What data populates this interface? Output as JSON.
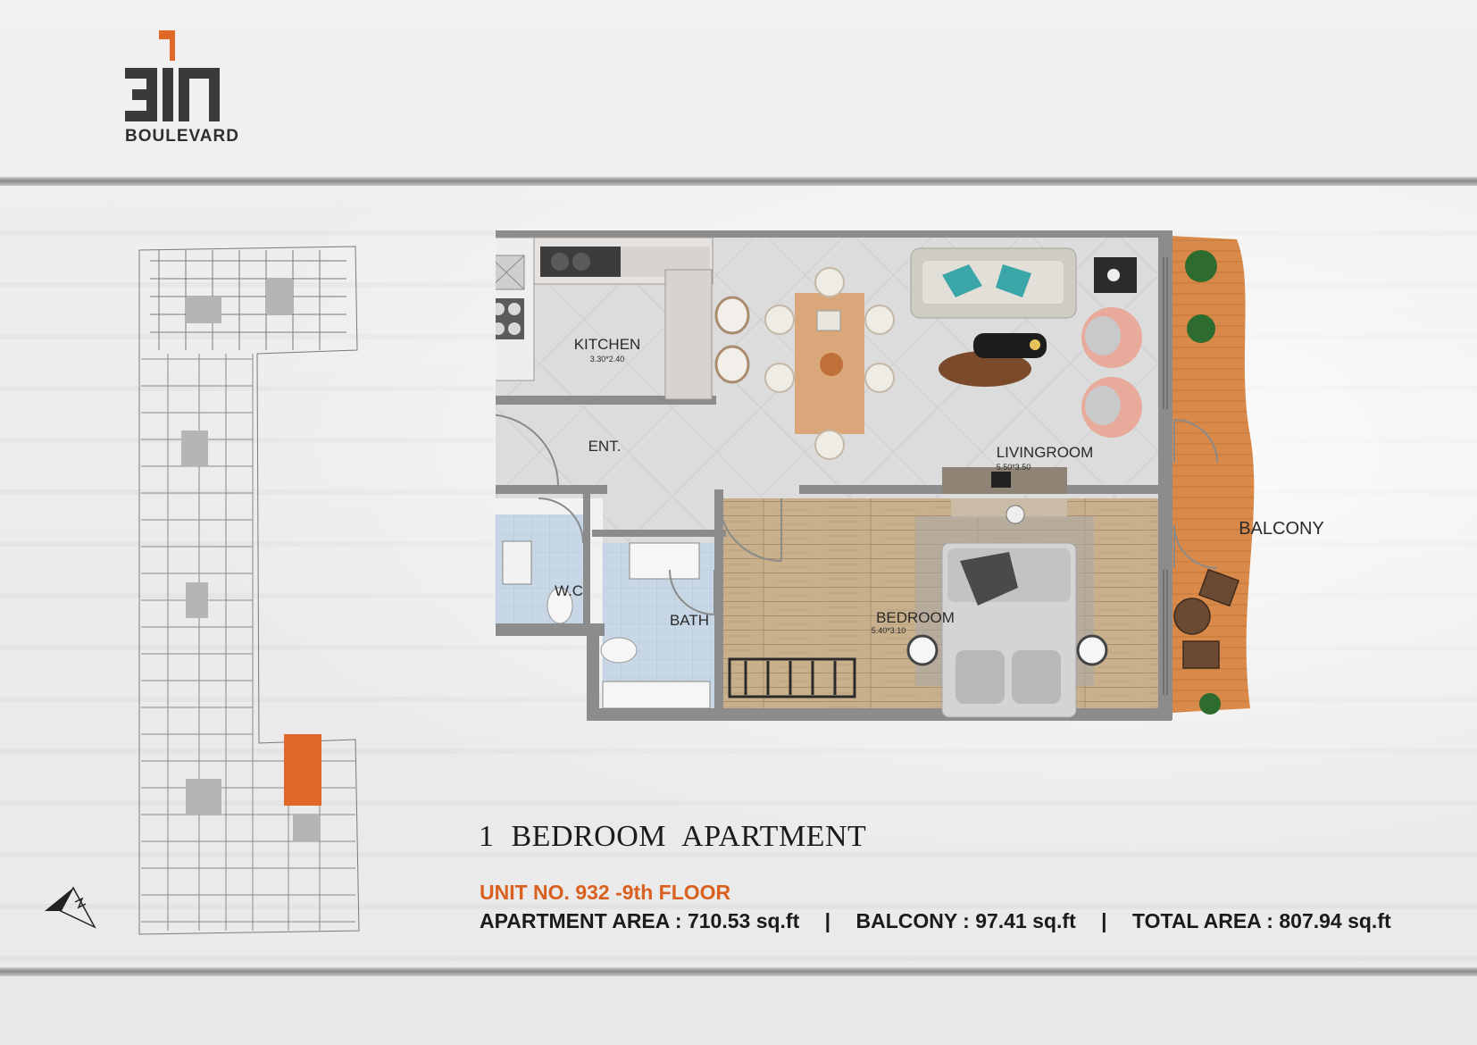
{
  "brand": {
    "logo_number": "311",
    "logo_word": "BOULEVARD",
    "accent": "#e0692a"
  },
  "plan_labels": {
    "kitchen": "KITCHEN",
    "kitchen_dims": "3.30*2.40",
    "entrance": "ENT.",
    "livingroom": "LIVINGROOM",
    "livingroom_dims": "5.50*3.50",
    "wc": "W.C",
    "bath": "BATH",
    "bedroom": "BEDROOM",
    "bedroom_dims": "5.40*3.10",
    "balcony": "BALCONY"
  },
  "title": "1 BEDROOM APARTMENT",
  "unit_line": "UNIT NO. 932 -9th FLOOR",
  "areas": {
    "apartment": "APARTMENT AREA : 710.53 sq.ft",
    "separator": "|",
    "balcony": "BALCONY : 97.41 sq.ft",
    "total": "TOTAL AREA : 807.94 sq.ft"
  },
  "colors": {
    "wall": "#8c8c8c",
    "floor_tile": "#dcdcdc",
    "wood_floor": "#c9b08d",
    "balcony_deck": "#d98a4a",
    "highlight_unit": "#e0692a"
  }
}
